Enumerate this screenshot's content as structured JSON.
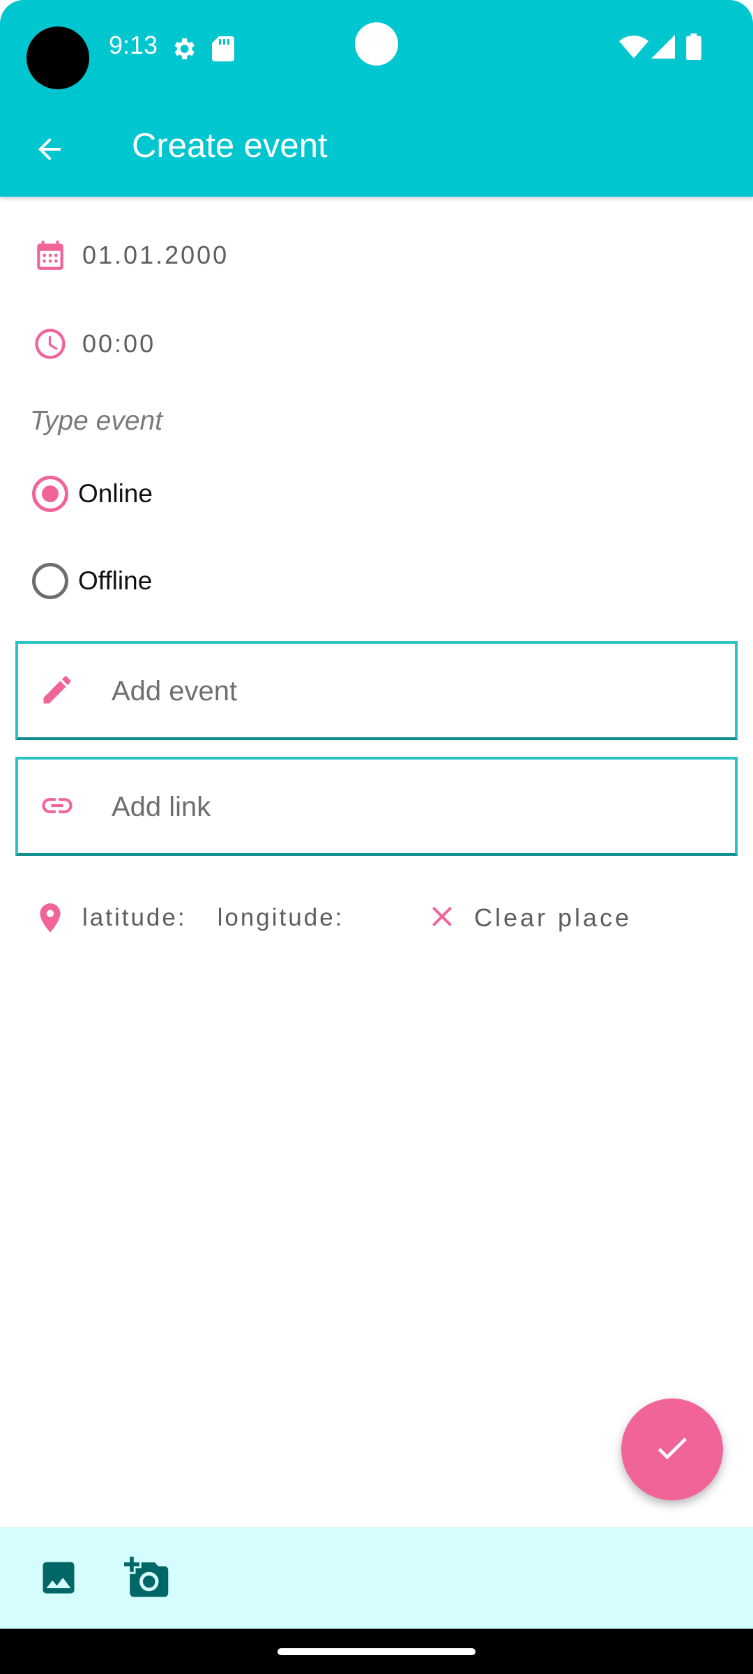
{
  "status_bar": {
    "time": "9:13",
    "icons": [
      "settings-icon",
      "sd-card-icon",
      "wifi-icon",
      "signal-icon",
      "battery-icon"
    ]
  },
  "app_bar": {
    "title": "Create event",
    "back_icon": "arrow-back-icon"
  },
  "form": {
    "date": {
      "icon": "calendar-icon",
      "value": "01.01.2000"
    },
    "time": {
      "icon": "clock-icon",
      "value": "00:00"
    },
    "type_label": "Type event",
    "type_options": [
      {
        "label": "Online",
        "checked": true
      },
      {
        "label": "Offline",
        "checked": false
      }
    ],
    "event_field": {
      "icon": "pencil-icon",
      "placeholder": "Add event",
      "value": ""
    },
    "link_field": {
      "icon": "link-icon",
      "placeholder": "Add link",
      "value": ""
    },
    "location": {
      "icon": "location-pin-icon",
      "latitude_label": "latitude:",
      "longitude_label": "longitude:",
      "clear_icon": "close-icon",
      "clear_label": "Clear place"
    }
  },
  "fab": {
    "icon": "check-icon"
  },
  "bottom_bar": {
    "icons": [
      "image-icon",
      "add-camera-icon"
    ]
  },
  "colors": {
    "primary": "#00c6cf",
    "accent": "#f0649a",
    "bottom_bar": "#d5fdfd",
    "bottom_icons": "#006666"
  }
}
